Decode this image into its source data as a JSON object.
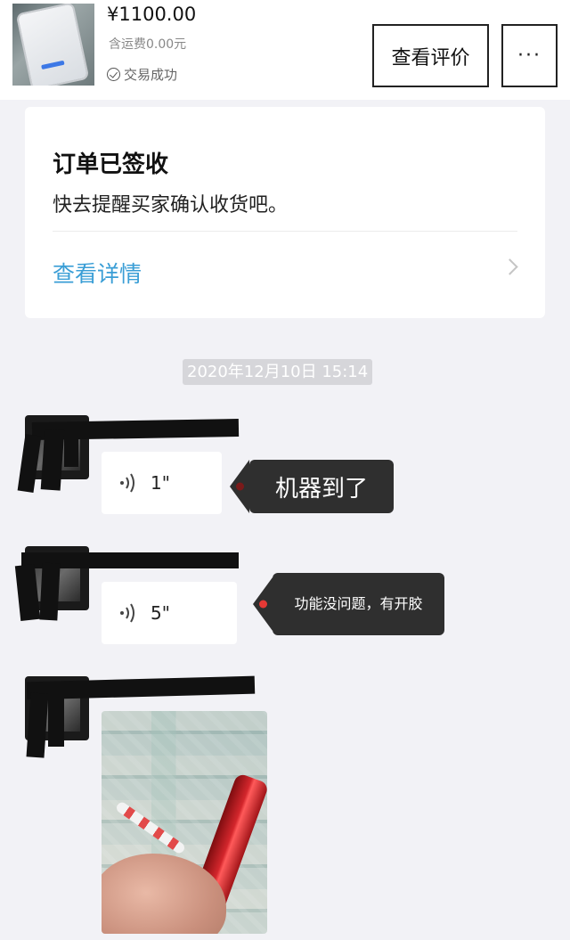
{
  "product": {
    "price": "¥1100.00",
    "shipping": "含运费0.00元",
    "status": "交易成功",
    "review_button": "查看评价",
    "more_button": "···"
  },
  "order_card": {
    "title": "订单已签收",
    "subtitle": "快去提醒买家确认收货吧。",
    "link": "查看详情"
  },
  "chat": {
    "timestamp": "2020年12月10日 15:14",
    "messages": [
      {
        "type": "voice",
        "duration": "1\"",
        "caption": "机器到了",
        "dot_color": "#7a1a1a"
      },
      {
        "type": "voice",
        "duration": "5\"",
        "caption": "功能没问题，有开胶",
        "dot_color": "#e53935"
      },
      {
        "type": "image"
      }
    ]
  }
}
